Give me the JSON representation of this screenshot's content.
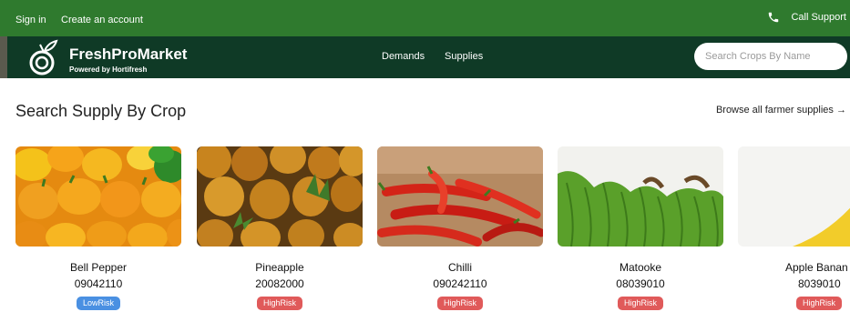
{
  "topbar": {
    "sign_in": "Sign in",
    "create_account": "Create an account",
    "call_support": "Call Support"
  },
  "brand": {
    "name": "FreshProMarket",
    "tagline": "Powered by Hortifresh"
  },
  "nav": {
    "demands": "Demands",
    "supplies": "Supplies"
  },
  "search": {
    "placeholder": "Search Crops By Name"
  },
  "section": {
    "title": "Search Supply By Crop",
    "browse_link": "Browse all farmer supplies →"
  },
  "crops": [
    {
      "name": "Bell Pepper",
      "code": "09042110",
      "risk": "LowRisk",
      "image_icon": "bell-pepper-image"
    },
    {
      "name": "Pineapple",
      "code": "20082000",
      "risk": "HighRisk",
      "image_icon": "pineapple-image"
    },
    {
      "name": "Chilli",
      "code": "090242110",
      "risk": "HighRisk",
      "image_icon": "chilli-image"
    },
    {
      "name": "Matooke",
      "code": "08039010",
      "risk": "HighRisk",
      "image_icon": "matooke-image"
    },
    {
      "name": "Apple Banan",
      "code": "8039010",
      "risk": "HighRisk",
      "image_icon": "apple-banana-image"
    }
  ],
  "colors": {
    "topbar": "#2f7a2e",
    "navbar": "#0f3a26",
    "low_risk": "#4a90e2",
    "high_risk": "#e05a5a"
  }
}
